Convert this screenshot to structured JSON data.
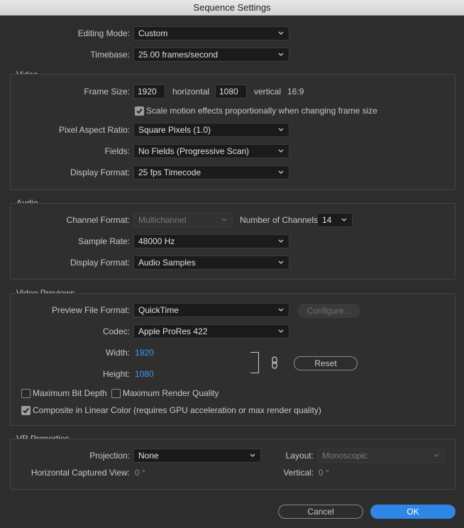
{
  "window": {
    "title": "Sequence Settings"
  },
  "general": {
    "editing_mode_label": "Editing Mode:",
    "editing_mode_value": "Custom",
    "timebase_label": "Timebase:",
    "timebase_value": "25.00  frames/second"
  },
  "video": {
    "group_title": "Video",
    "frame_size_label": "Frame Size:",
    "frame_width": "1920",
    "horizontal_label": "horizontal",
    "frame_height": "1080",
    "vertical_label": "vertical",
    "aspect_ratio": "16:9",
    "scale_motion_label": "Scale motion effects proportionally when changing frame size",
    "scale_motion_checked": true,
    "pixel_aspect_label": "Pixel Aspect Ratio:",
    "pixel_aspect_value": "Square Pixels (1.0)",
    "fields_label": "Fields:",
    "fields_value": "No Fields (Progressive Scan)",
    "display_format_label": "Display Format:",
    "display_format_value": "25 fps Timecode"
  },
  "audio": {
    "group_title": "Audio",
    "channel_format_label": "Channel Format:",
    "channel_format_value": "Multichannel",
    "num_channels_label": "Number of Channels:",
    "num_channels_value": "14",
    "sample_rate_label": "Sample Rate:",
    "sample_rate_value": "48000 Hz",
    "display_format_label": "Display Format:",
    "display_format_value": "Audio Samples"
  },
  "previews": {
    "group_title": "Video Previews",
    "file_format_label": "Preview File Format:",
    "file_format_value": "QuickTime",
    "configure_label": "Configure...",
    "codec_label": "Codec:",
    "codec_value": "Apple ProRes 422",
    "width_label": "Width:",
    "width_value": "1920",
    "height_label": "Height:",
    "height_value": "1080",
    "reset_label": "Reset",
    "max_bit_depth_label": "Maximum Bit Depth",
    "max_bit_depth_checked": false,
    "max_render_quality_label": "Maximum Render Quality",
    "max_render_quality_checked": false,
    "linear_color_label": "Composite in Linear Color (requires GPU acceleration or max render quality)",
    "linear_color_checked": true
  },
  "vr": {
    "group_title": "VR Properties",
    "projection_label": "Projection:",
    "projection_value": "None",
    "layout_label": "Layout:",
    "layout_value": "Monoscopic",
    "h_view_label": "Horizontal Captured View:",
    "h_view_value": "0 °",
    "vertical_label": "Vertical:",
    "vertical_value": "0 °"
  },
  "footer": {
    "cancel_label": "Cancel",
    "ok_label": "OK"
  },
  "colors": {
    "accent": "#2f86e4",
    "link_blue": "#3d9bf0",
    "background": "#2d2d2d"
  },
  "icons": {
    "dropdown": "chevron-down-icon",
    "link": "chain-link-icon",
    "check": "checkmark-icon"
  }
}
